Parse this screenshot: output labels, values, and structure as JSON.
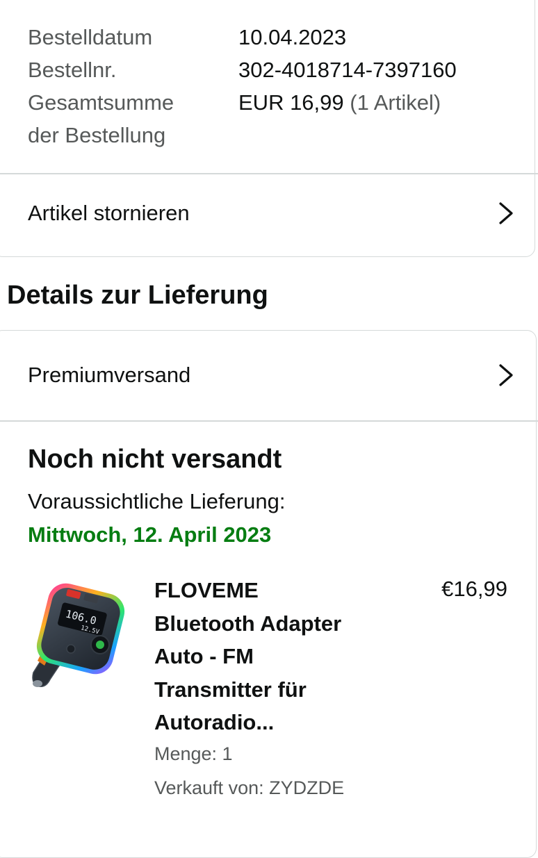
{
  "order_summary": {
    "order_date_label": "Bestelldatum",
    "order_date": "10.04.2023",
    "order_number_label": "Bestellnr.",
    "order_number": "302-4018714-7397160",
    "total_label_line1": "Gesamtsumme",
    "total_label_line2": "der Bestellung",
    "total_amount": "EUR 16,99",
    "total_items": "(1 Artikel)"
  },
  "cancel_items": {
    "label": "Artikel stornieren",
    "icon": "chevron-right-icon"
  },
  "delivery_section": {
    "title": "Details zur Lieferung",
    "shipping_method": "Premiumversand",
    "status": "Noch nicht versandt",
    "estimated_delivery_label": "Voraussichtliche Lieferung:",
    "estimated_delivery_date": "Mittwoch, 12. April 2023",
    "date_color": "#067d12"
  },
  "product": {
    "title_lines": [
      "FLOVEME",
      "Bluetooth Adapter",
      "Auto - FM",
      "Transmitter für",
      "Autoradio..."
    ],
    "price": "€16,99",
    "quantity": "Menge: 1",
    "seller": "Verkauft von: ZYDZDE",
    "display_frequency": "106.0",
    "display_voltage": "12.5V"
  }
}
